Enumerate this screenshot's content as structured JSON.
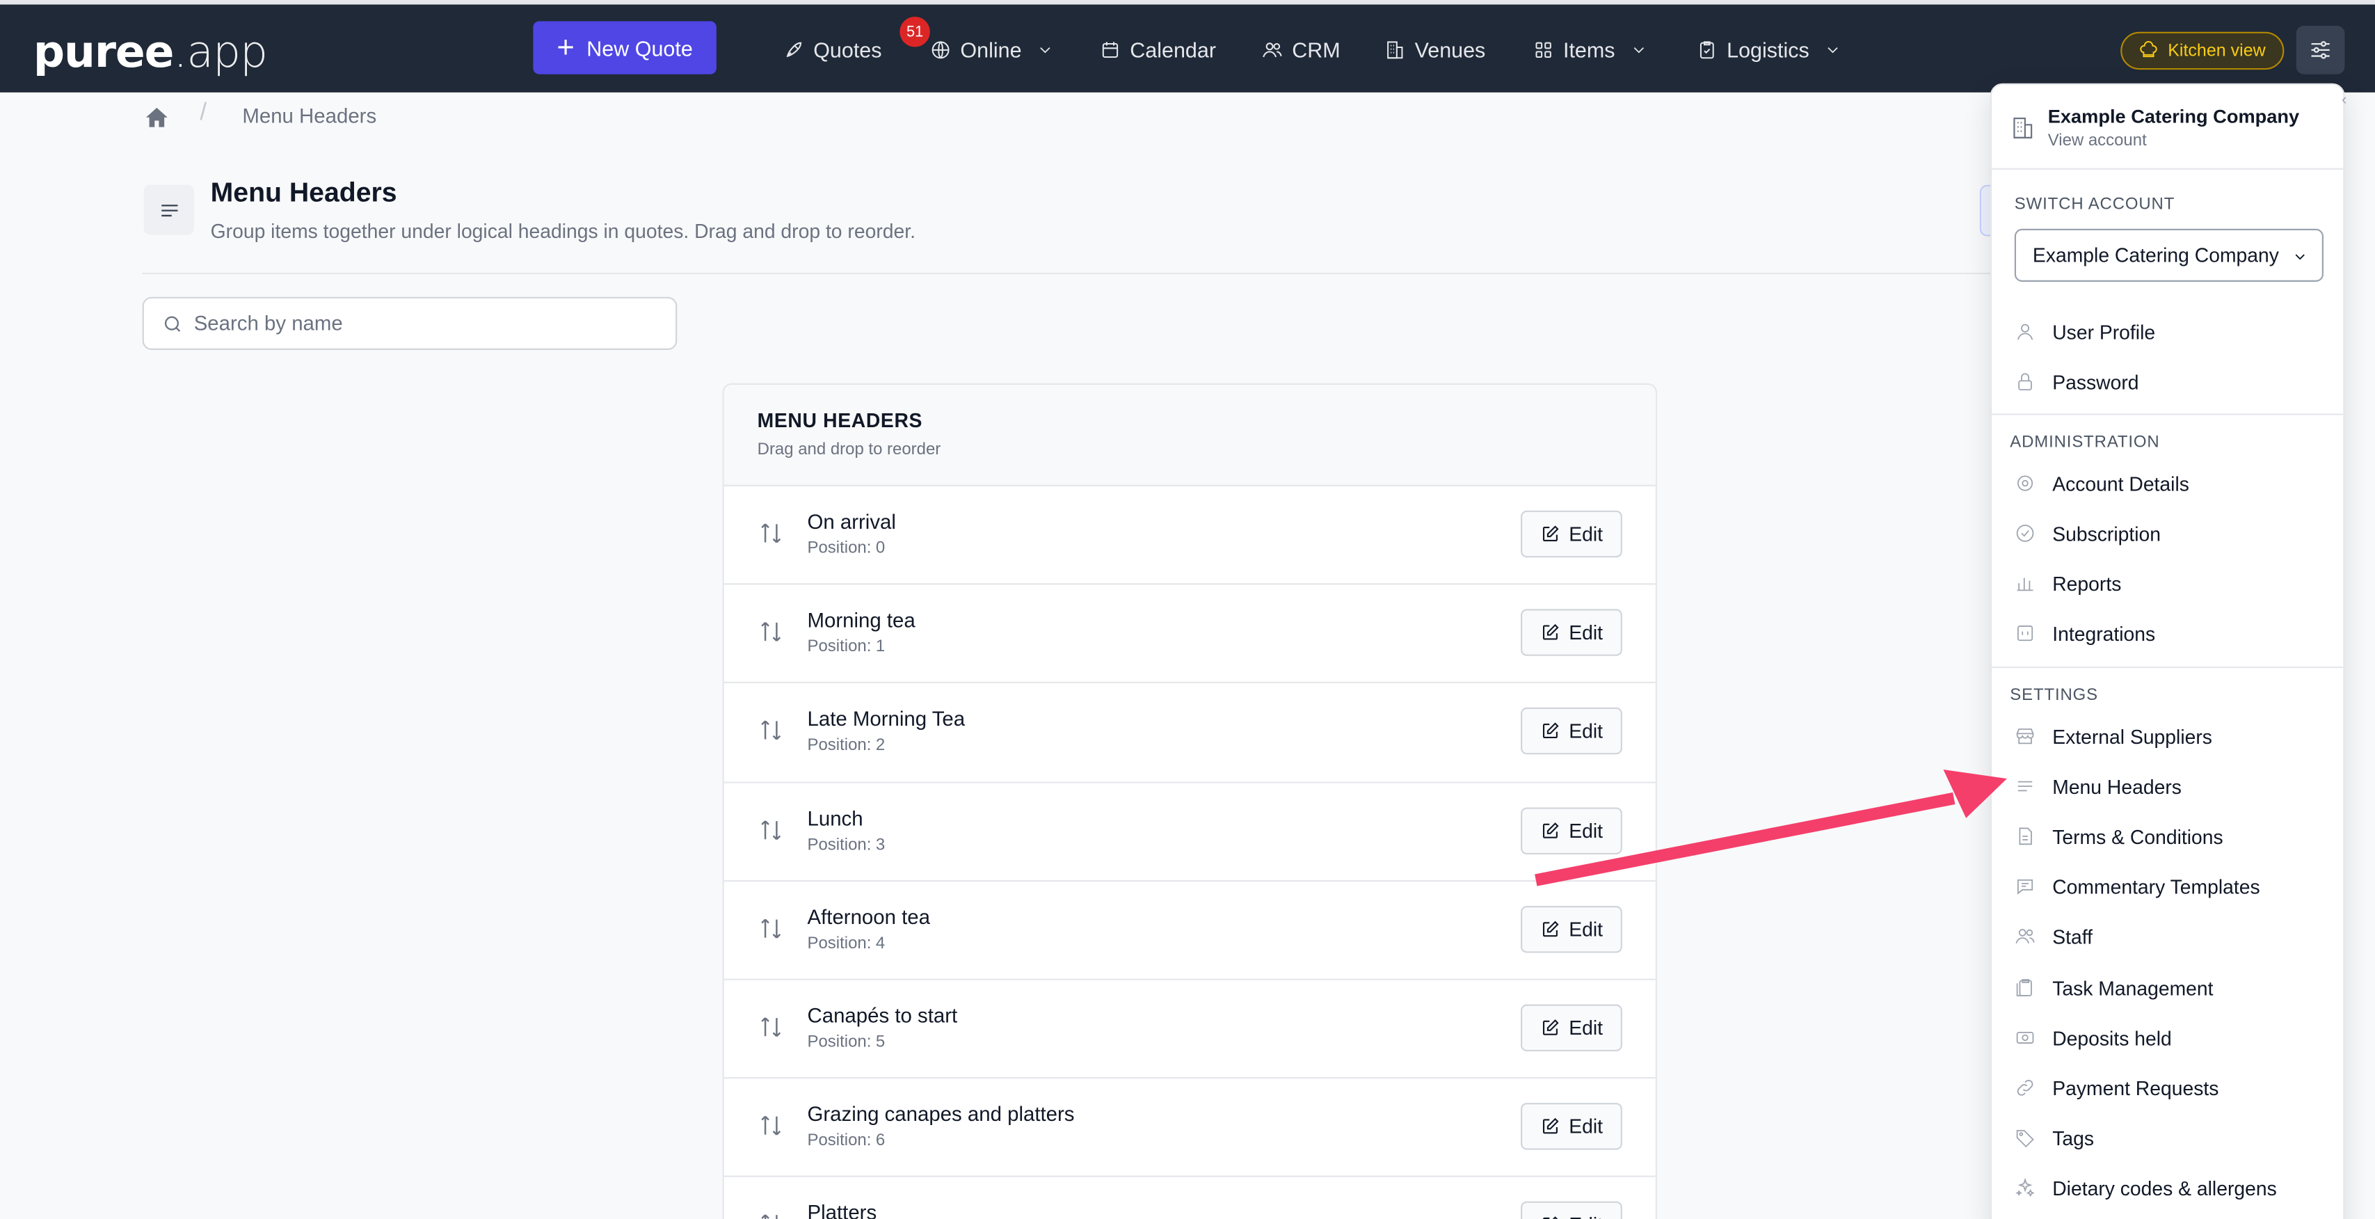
{
  "nav": {
    "logo_bold": "puree",
    "logo_light": ".app",
    "new_quote": "New Quote",
    "quotes": "Quotes",
    "quotes_badge": "51",
    "online": "Online",
    "calendar": "Calendar",
    "crm": "CRM",
    "venues": "Venues",
    "items": "Items",
    "logistics": "Logistics",
    "kitchen_view": "Kitchen view",
    "accent": "#4f46e5"
  },
  "breadcrumb": {
    "separator": "/",
    "current": "Menu Headers"
  },
  "header": {
    "title": "Menu Headers",
    "subtitle": "Group items together under logical headings in quotes. Drag and drop to reorder."
  },
  "search": {
    "placeholder": "Search by name",
    "value": ""
  },
  "list": {
    "title": "MENU HEADERS",
    "subtitle": "Drag and drop to reorder",
    "position_label": "Position:",
    "edit_label": "Edit",
    "rows": [
      {
        "name": "On arrival",
        "position": "0"
      },
      {
        "name": "Morning tea",
        "position": "1"
      },
      {
        "name": "Late Morning Tea",
        "position": "2"
      },
      {
        "name": "Lunch",
        "position": "3"
      },
      {
        "name": "Afternoon tea",
        "position": "4"
      },
      {
        "name": "Canapés to start",
        "position": "5"
      },
      {
        "name": "Grazing canapes and platters",
        "position": "6"
      },
      {
        "name": "Platters",
        "position": ""
      }
    ]
  },
  "menu": {
    "account_name": "Example Catering Company",
    "view_account": "View account",
    "switch_label": "SWITCH ACCOUNT",
    "switch_selected": "Example Catering Company",
    "user_items": [
      "User Profile",
      "Password"
    ],
    "admin_label": "ADMINISTRATION",
    "admin_items": [
      "Account Details",
      "Subscription",
      "Reports",
      "Integrations"
    ],
    "settings_label": "SETTINGS",
    "settings_items": [
      "External Suppliers",
      "Menu Headers",
      "Terms & Conditions",
      "Commentary Templates",
      "Staff",
      "Task Management",
      "Deposits held",
      "Payment Requests",
      "Tags",
      "Dietary codes & allergens"
    ],
    "arrow_color": "#f43f6b"
  }
}
